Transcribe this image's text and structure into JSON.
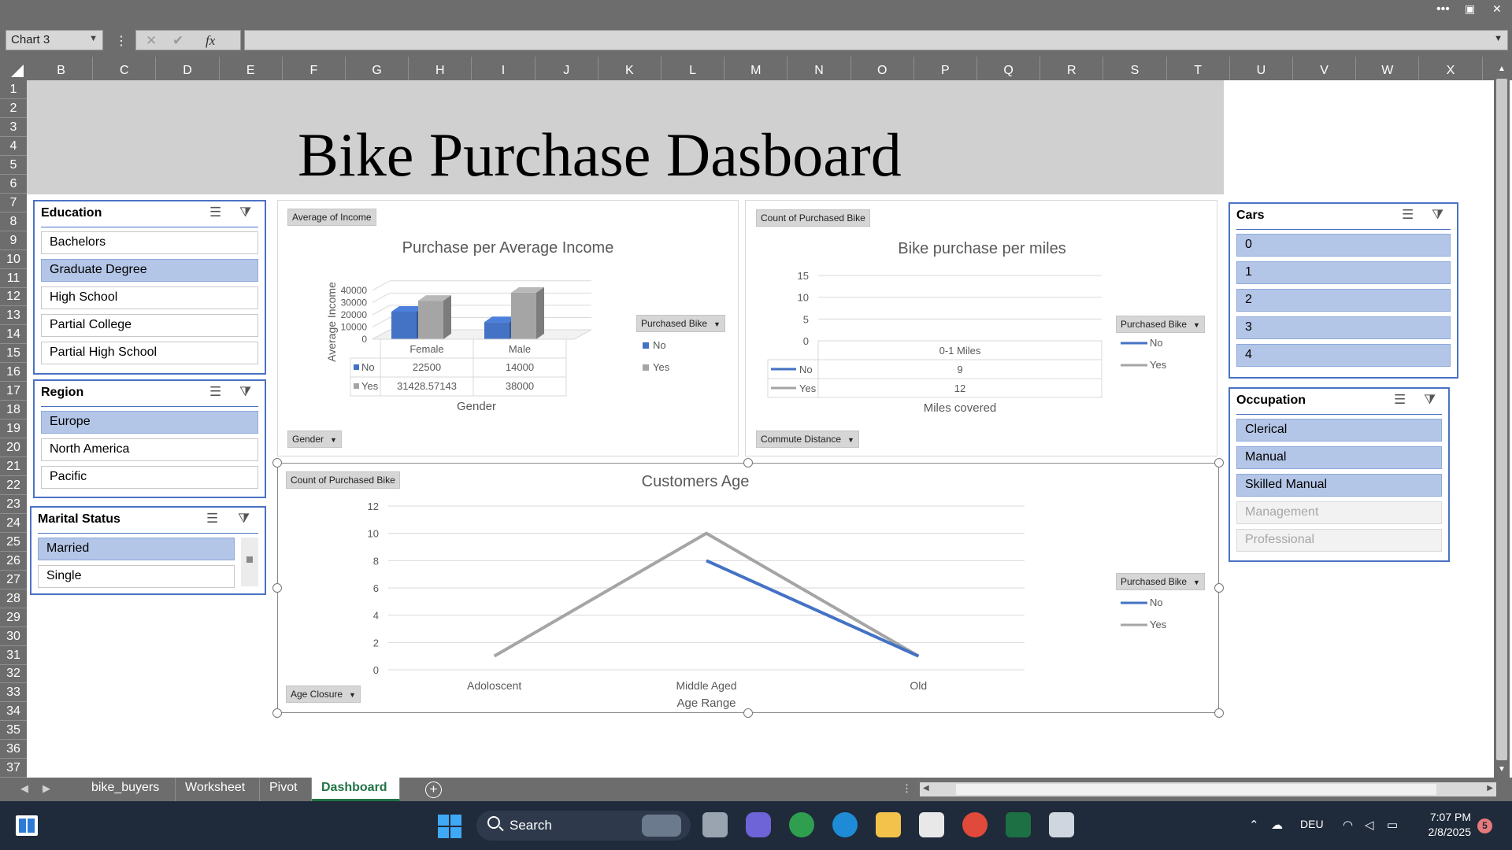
{
  "window": {
    "more_label": "•••",
    "close_label": "✕"
  },
  "formula_bar": {
    "name_box": "Chart 3",
    "formula_value": ""
  },
  "columns": [
    "B",
    "C",
    "D",
    "E",
    "F",
    "G",
    "H",
    "I",
    "J",
    "K",
    "L",
    "M",
    "N",
    "O",
    "P",
    "Q",
    "R",
    "S",
    "T",
    "U",
    "V",
    "W",
    "X"
  ],
  "rows": [
    "1",
    "2",
    "3",
    "4",
    "5",
    "6",
    "7",
    "8",
    "9",
    "10",
    "11",
    "12",
    "13",
    "14",
    "15",
    "16",
    "17",
    "18",
    "19",
    "20",
    "21",
    "22",
    "23",
    "24",
    "25",
    "26",
    "27",
    "28",
    "29",
    "30",
    "31",
    "32",
    "33",
    "34",
    "35",
    "36",
    "37"
  ],
  "dashboard": {
    "title": "Bike Purchase Dasboard"
  },
  "slicers": {
    "education": {
      "title": "Education",
      "items": [
        {
          "label": "Bachelors",
          "state": "normal"
        },
        {
          "label": "Graduate Degree",
          "state": "selected"
        },
        {
          "label": "High School",
          "state": "normal"
        },
        {
          "label": "Partial College",
          "state": "normal"
        },
        {
          "label": "Partial High School",
          "state": "normal"
        }
      ]
    },
    "region": {
      "title": "Region",
      "items": [
        {
          "label": "Europe",
          "state": "selected"
        },
        {
          "label": "North America",
          "state": "normal"
        },
        {
          "label": "Pacific",
          "state": "normal"
        }
      ]
    },
    "marital": {
      "title": "Marital Status",
      "items": [
        {
          "label": "Married",
          "state": "selected"
        },
        {
          "label": "Single",
          "state": "normal"
        }
      ]
    },
    "cars": {
      "title": "Cars",
      "items": [
        {
          "label": "0",
          "state": "selected"
        },
        {
          "label": "1",
          "state": "selected"
        },
        {
          "label": "2",
          "state": "selected"
        },
        {
          "label": "3",
          "state": "selected"
        },
        {
          "label": "4",
          "state": "selected"
        }
      ]
    },
    "occupation": {
      "title": "Occupation",
      "items": [
        {
          "label": "Clerical",
          "state": "selected"
        },
        {
          "label": "Manual",
          "state": "selected"
        },
        {
          "label": "Skilled Manual",
          "state": "selected"
        },
        {
          "label": "Management",
          "state": "dimmed"
        },
        {
          "label": "Professional",
          "state": "dimmed"
        }
      ]
    }
  },
  "charts": {
    "income": {
      "value_button": "Average of Income",
      "axis_button": "Gender",
      "legend_button": "Purchased Bike"
    },
    "miles": {
      "value_button": "Count of Purchased Bike",
      "axis_button": "Commute Distance",
      "legend_button": "Purchased Bike"
    },
    "age": {
      "value_button": "Count of Purchased Bike",
      "axis_button": "Age Closure",
      "legend_button": "Purchased Bike"
    }
  },
  "chart_data": [
    {
      "type": "bar",
      "title": "Purchase per Average Income",
      "xlabel": "Gender",
      "ylabel": "Average Income",
      "categories": [
        "Female",
        "Male"
      ],
      "series": [
        {
          "name": "No",
          "values": [
            22500,
            14000
          ],
          "labels": [
            "22500",
            "14000"
          ],
          "color": "#4472c4"
        },
        {
          "name": "Yes",
          "values": [
            31428.57143,
            38000
          ],
          "labels": [
            "31428.57143",
            "38000"
          ],
          "color": "#a5a5a5"
        }
      ],
      "yticks": [
        "0",
        "10000",
        "20000",
        "30000",
        "40000"
      ],
      "ylim": [
        0,
        45000
      ],
      "legend": "right",
      "data_table": true,
      "three_d": true
    },
    {
      "type": "line",
      "title": "Bike purchase per miles",
      "xlabel": "Miles covered",
      "ylabel": "",
      "categories": [
        "0-1 Miles"
      ],
      "series": [
        {
          "name": "No",
          "values": [
            9
          ],
          "labels": [
            "9"
          ],
          "color": "#4472c4"
        },
        {
          "name": "Yes",
          "values": [
            12
          ],
          "labels": [
            "12"
          ],
          "color": "#a5a5a5"
        }
      ],
      "yticks": [
        "0",
        "5",
        "10",
        "15"
      ],
      "ylim": [
        0,
        15
      ],
      "legend": "right",
      "data_table": true
    },
    {
      "type": "line",
      "title": "Customers Age",
      "xlabel": "Age Range",
      "ylabel": "",
      "categories": [
        "Adoloscent",
        "Middle Aged",
        "Old"
      ],
      "series": [
        {
          "name": "No",
          "values": [
            null,
            8,
            1
          ],
          "color": "#4472c4"
        },
        {
          "name": "Yes",
          "values": [
            1,
            10,
            1
          ],
          "color": "#a5a5a5"
        }
      ],
      "yticks": [
        "0",
        "2",
        "4",
        "6",
        "8",
        "10",
        "12"
      ],
      "ylim": [
        0,
        12
      ],
      "legend": "right",
      "grid": true
    }
  ],
  "sheet_tabs": [
    {
      "label": "bike_buyers",
      "active": false
    },
    {
      "label": "Worksheet",
      "active": false
    },
    {
      "label": "Pivot",
      "active": false
    },
    {
      "label": "Dashboard",
      "active": true
    }
  ],
  "taskbar": {
    "search_label": "Search",
    "language": "DEU",
    "time": "7:07 PM",
    "date": "2/8/2025",
    "notifications": "5"
  }
}
